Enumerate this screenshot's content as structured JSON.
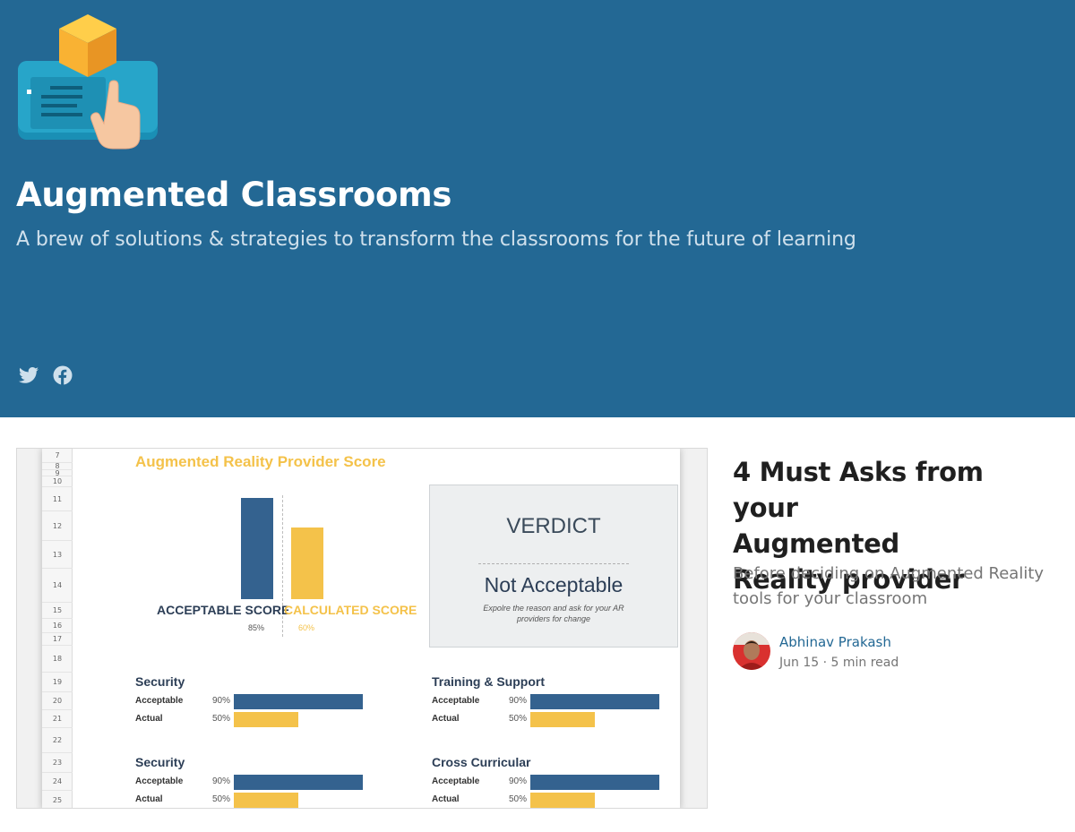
{
  "header": {
    "logo_icon": "ar-cube-hand-icon",
    "title": "Augmented Classrooms",
    "tagline": "A brew of solutions & strategies to transform the classrooms for the future of learning",
    "background": "#236894",
    "social": [
      {
        "name": "twitter-icon"
      },
      {
        "name": "facebook-icon"
      }
    ]
  },
  "article": {
    "title_lines": [
      "4 Must Asks from your",
      "Augmented",
      "Reality provider"
    ],
    "subtitle": "Before deciding on Augmented Reality tools for your classroom",
    "author": "Abhinav Prakash",
    "date": "Jun 15",
    "separator": "·",
    "read_time": "5 min read",
    "image": {
      "row_numbers": [
        "7",
        "8",
        "9",
        "10",
        "11",
        "12",
        "13",
        "14",
        "15",
        "16",
        "17",
        "18",
        "19",
        "20",
        "21",
        "22",
        "23",
        "24",
        "25"
      ],
      "title": "Augmented Reality Provider Score",
      "acceptable_label": "ACCEPTABLE SCORE",
      "acceptable_pct": "85%",
      "calculated_label": "CALCULATED SCORE",
      "calculated_pct": "60%",
      "verdict_heading": "VERDICT",
      "verdict_value": "Not Acceptable",
      "verdict_note": "Expolre the reason and ask for your AR providers for change",
      "metrics": [
        {
          "title": "Security",
          "acceptable_label": "Acceptable",
          "acceptable_pct": "90%",
          "actual_label": "Actual",
          "actual_pct": "50%"
        },
        {
          "title": "Training & Support",
          "acceptable_label": "Acceptable",
          "acceptable_pct": "90%",
          "actual_label": "Actual",
          "actual_pct": "50%"
        },
        {
          "title": "Security",
          "acceptable_label": "Acceptable",
          "acceptable_pct": "90%",
          "actual_label": "Actual",
          "actual_pct": "50%"
        },
        {
          "title": "Cross Curricular",
          "acceptable_label": "Acceptable",
          "acceptable_pct": "90%",
          "actual_label": "Actual",
          "actual_pct": "50%"
        }
      ]
    }
  },
  "colors": {
    "accent_blue": "#34628f",
    "accent_yellow": "#f4c24a",
    "link": "#236894"
  }
}
